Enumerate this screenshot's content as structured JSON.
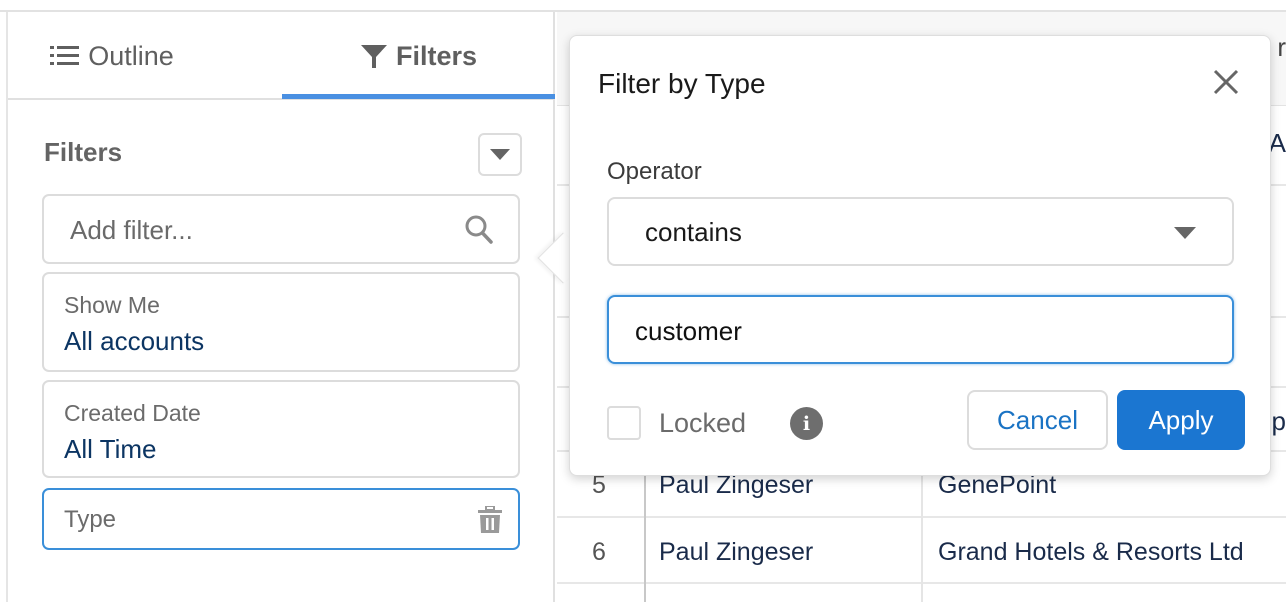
{
  "sidebar": {
    "tabs": [
      {
        "label": "Outline",
        "icon": "list-icon",
        "active": false
      },
      {
        "label": "Filters",
        "icon": "funnel-icon",
        "active": true
      }
    ],
    "heading": "Filters",
    "add_filter_placeholder": "Add filter...",
    "filters": [
      {
        "label": "Show Me",
        "value": "All accounts"
      },
      {
        "label": "Created Date",
        "value": "All Time"
      },
      {
        "label": "Type",
        "value": ""
      }
    ],
    "accent_color": "#4a90e2"
  },
  "table": {
    "header_fragment": "r",
    "rows": [
      {
        "num": "",
        "owner": "",
        "account": "",
        "fragment": "A"
      },
      {
        "num": "",
        "owner": "",
        "account": "",
        "fragment": ""
      },
      {
        "num": "",
        "owner": "",
        "account": "",
        "fragment": ""
      },
      {
        "num": "",
        "owner": "",
        "account": "",
        "fragment": "sp"
      },
      {
        "num": "5",
        "owner": "Paul Zingeser",
        "account": "GenePoint",
        "fragment": ""
      },
      {
        "num": "6",
        "owner": "Paul Zingeser",
        "account": "Grand Hotels & Resorts Ltd",
        "fragment": ""
      }
    ]
  },
  "popover": {
    "title": "Filter by Type",
    "operator_label": "Operator",
    "operator_value": "contains",
    "value_input": "customer",
    "locked_label": "Locked",
    "locked_checked": false,
    "cancel_label": "Cancel",
    "apply_label": "Apply",
    "apply_color": "#1b76d1"
  }
}
